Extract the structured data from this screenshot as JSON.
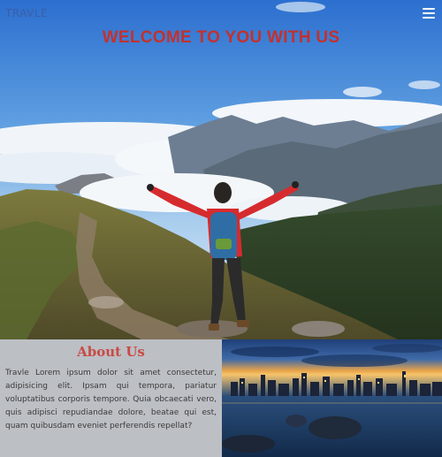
{
  "header": {
    "brand": "TRAVLE",
    "menu_icon": "hamburger-menu-icon"
  },
  "hero": {
    "title": "WELCOME TO YOU WITH US"
  },
  "about": {
    "title": "About Us",
    "text": "Travle Lorem ipsum dolor sit amet consectetur, adipisicing elit. Ipsam qui tempora, pariatur voluptatibus corporis tempore. Quia obcaecati vero, quis adipisci repudiandae dolore, beatae qui est, quam quibusdam eveniet perferendis repellat?"
  },
  "colors": {
    "title_red": "#c3312e",
    "brand_blue": "#3b5ea8",
    "about_bg": "#bcbfc4",
    "about_title": "#c84b44"
  }
}
